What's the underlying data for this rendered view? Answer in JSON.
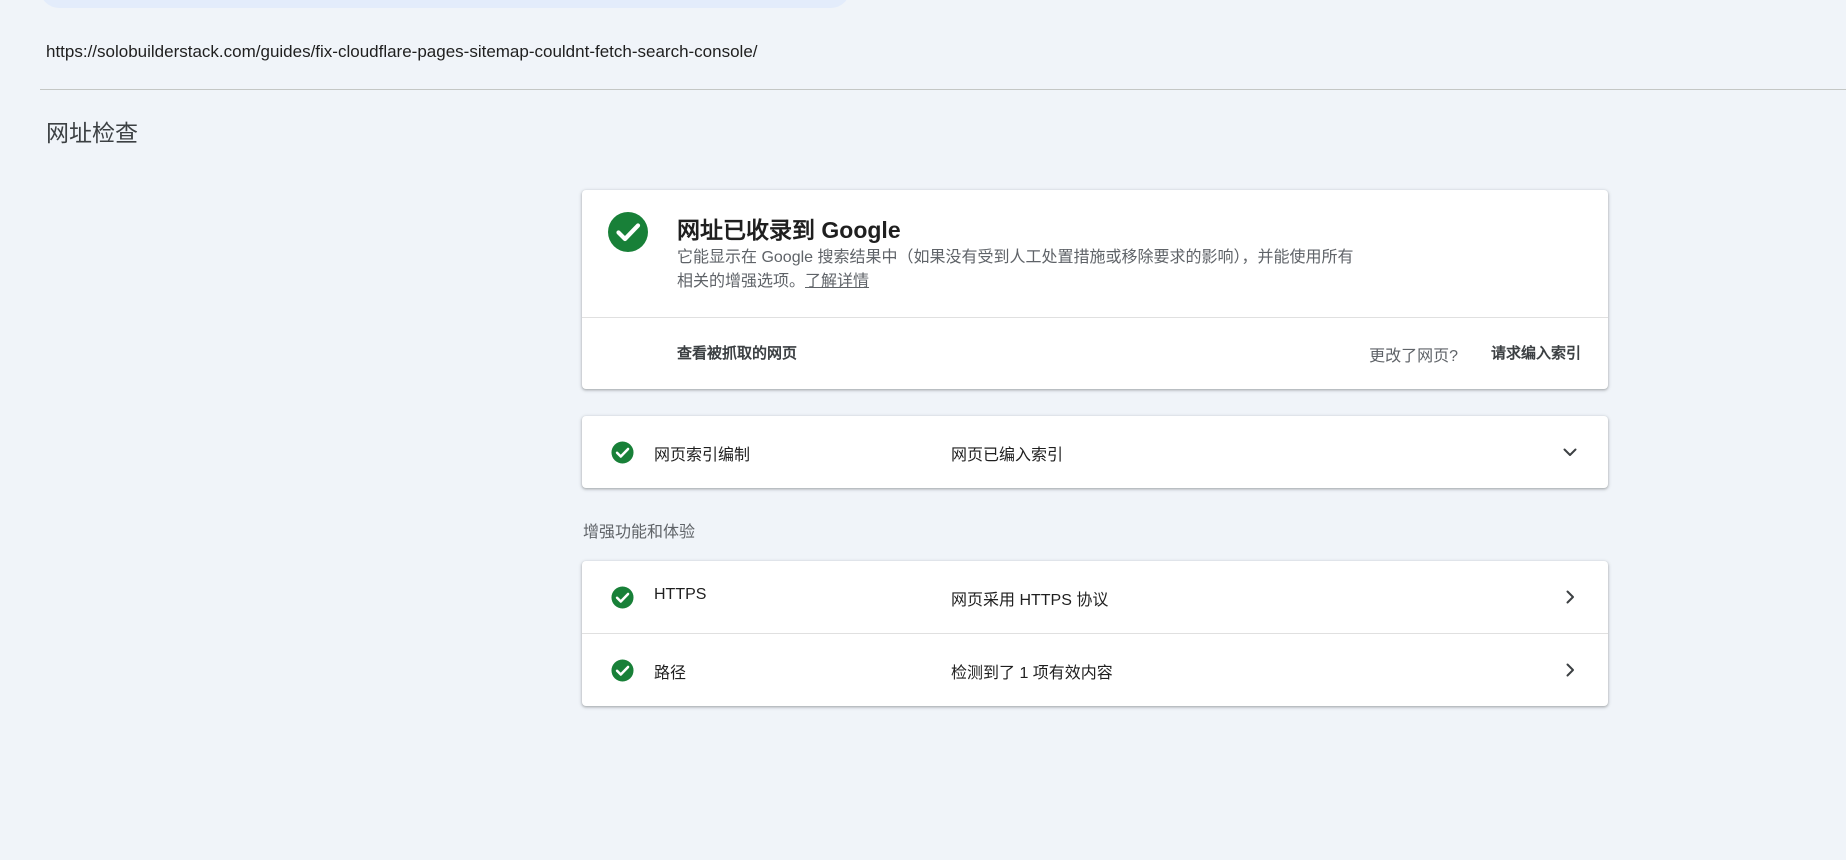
{
  "url": "https://solobuilderstack.com/guides/fix-cloudflare-pages-sitemap-couldnt-fetch-search-console/",
  "page_title": "网址检查",
  "status": {
    "title": "网址已收录到 Google",
    "description": "它能显示在 Google 搜索结果中（如果没有受到人工处置措施或移除要求的影响），并能使用所有相关的增强选项。",
    "learn_more": "了解详情",
    "view_crawled": "查看被抓取的网页",
    "changed_question": "更改了网页?",
    "request_indexing": "请求编入索引",
    "icon": "check-circle-icon",
    "color": "#188038"
  },
  "indexing": {
    "label": "网页索引编制",
    "value": "网页已编入索引"
  },
  "enhancements": {
    "section_label": "增强功能和体验",
    "items": [
      {
        "label": "HTTPS",
        "value": "网页采用 HTTPS 协议"
      },
      {
        "label": "路径",
        "value": "检测到了 1 项有效内容"
      }
    ]
  }
}
